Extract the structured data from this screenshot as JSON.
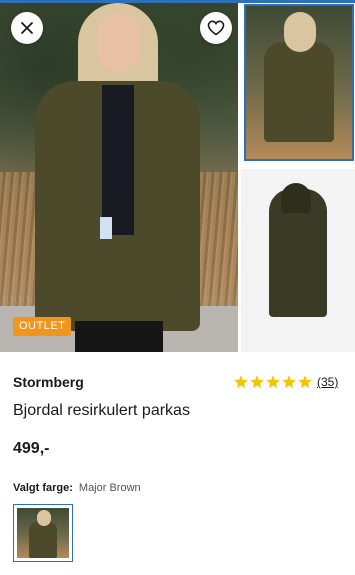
{
  "gallery": {
    "close_icon": "close-icon",
    "favorite_icon": "heart-outline-icon",
    "badge": "OUTLET"
  },
  "product": {
    "brand": "Stormberg",
    "rating": 5,
    "review_count": "(35)",
    "title": "Bjordal resirkulert parkas",
    "price": "499,-",
    "color_label": "Valgt farge:",
    "color_value": "Major Brown"
  },
  "colors": {
    "accent": "#2d6fb8",
    "badge": "#f0961e",
    "star": "#f5c400"
  }
}
